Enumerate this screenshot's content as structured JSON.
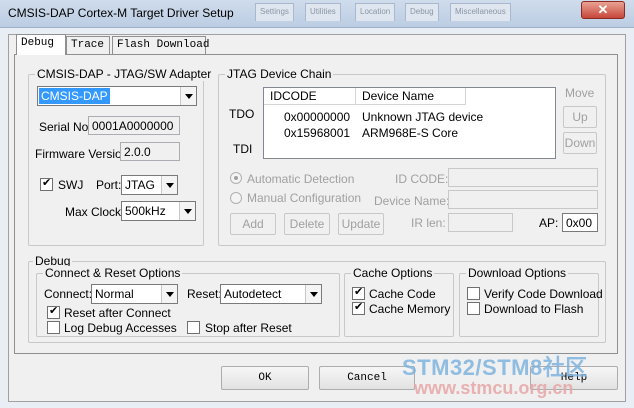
{
  "window": {
    "title": "CMSIS-DAP Cortex-M Target Driver Setup",
    "close_label": "✕",
    "background_tabs": [
      "Settings",
      "Utilities",
      "Location",
      "Debug",
      "Miscellaneous"
    ]
  },
  "tabs": [
    {
      "label": "Debug",
      "active": true
    },
    {
      "label": "Trace",
      "active": false
    },
    {
      "label": "Flash Download",
      "active": false
    }
  ],
  "adapter": {
    "title": "CMSIS-DAP - JTAG/SW Adapter",
    "selected": "CMSIS-DAP",
    "serial_label": "Serial No:",
    "serial_value": "0001A0000000",
    "firmware_label": "Firmware Version:",
    "firmware_value": "2.0.0",
    "swj_label": "SWJ",
    "swj_checked": true,
    "port_label": "Port:",
    "port_value": "JTAG",
    "maxclock_label": "Max Clock:",
    "maxclock_value": "500kHz"
  },
  "jtag": {
    "title": "JTAG Device Chain",
    "tdo_label": "TDO",
    "tdi_label": "TDI",
    "columns": [
      "IDCODE",
      "Device Name"
    ],
    "rows": [
      {
        "idcode": "0x00000000",
        "name": "Unknown JTAG device"
      },
      {
        "idcode": "0x15968001",
        "name": "ARM968E-S Core"
      }
    ],
    "move_label": "Move",
    "up_label": "Up",
    "down_label": "Down",
    "auto_detect_label": "Automatic Detection",
    "manual_config_label": "Manual Configuration",
    "id_code_label": "ID CODE:",
    "device_name_label": "Device Name:",
    "add_label": "Add",
    "delete_label": "Delete",
    "update_label": "Update",
    "ir_len_label": "IR len:",
    "ap_label": "AP:",
    "ap_value": "0x00"
  },
  "debug": {
    "title": "Debug",
    "connect_reset_title": "Connect & Reset Options",
    "connect_label": "Connect:",
    "connect_value": "Normal",
    "reset_label": "Reset:",
    "reset_value": "Autodetect",
    "reset_after_connect_label": "Reset after Connect",
    "reset_after_connect_checked": true,
    "log_debug_label": "Log Debug Accesses",
    "log_debug_checked": false,
    "stop_after_reset_label": "Stop after Reset",
    "stop_after_reset_checked": false,
    "cache_title": "Cache Options",
    "cache_code_label": "Cache Code",
    "cache_code_checked": true,
    "cache_memory_label": "Cache Memory",
    "cache_memory_checked": true,
    "download_title": "Download Options",
    "verify_label": "Verify Code Download",
    "verify_checked": false,
    "download_flash_label": "Download to Flash",
    "download_flash_checked": false
  },
  "footer": {
    "ok_label": "OK",
    "cancel_label": "Cancel",
    "help_label": "Help"
  },
  "watermark": {
    "line1": "STM32/STM8社区",
    "line2": "www.stmcu.org.cn"
  }
}
